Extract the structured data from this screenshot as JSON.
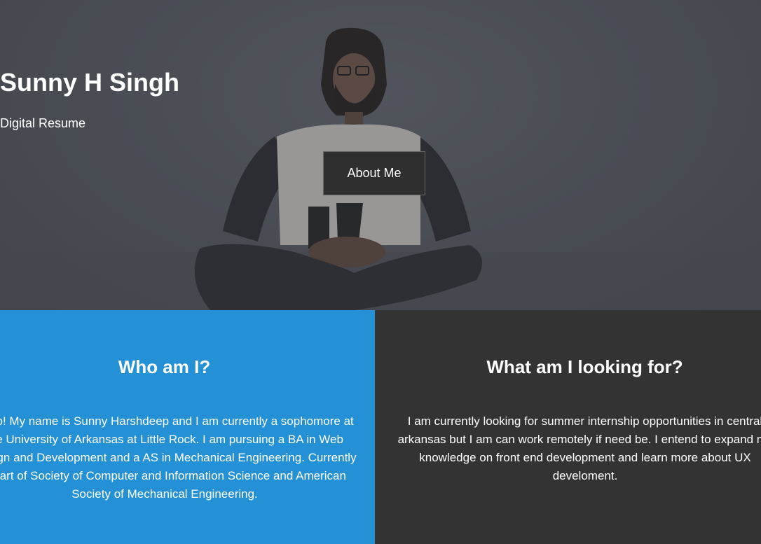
{
  "hero": {
    "title": "Sunny H Singh",
    "subtitle": "Digital Resume",
    "button_label": "About Me"
  },
  "panels": {
    "who": {
      "title": "Who am I?",
      "text": "Hello! My name is Sunny Harshdeep and I am currently a sophomore at the University of Arkansas at Little Rock. I am pursuing a BA in Web Design and Development and a AS in Mechanical Engineering. Currently a part of Society of Computer and Information Science and American Society of Mechanical Engineering."
    },
    "looking": {
      "title": "What am I looking for?",
      "text": "I am currently looking for summer internship opportunities in central arkansas but I am can work remotely if need be. I entend to expand my knowledge on front end development and learn more about UX develoment."
    }
  },
  "colors": {
    "left_panel": "#2490d5",
    "right_panel": "#333333",
    "button_bg": "#2f2f2f"
  }
}
